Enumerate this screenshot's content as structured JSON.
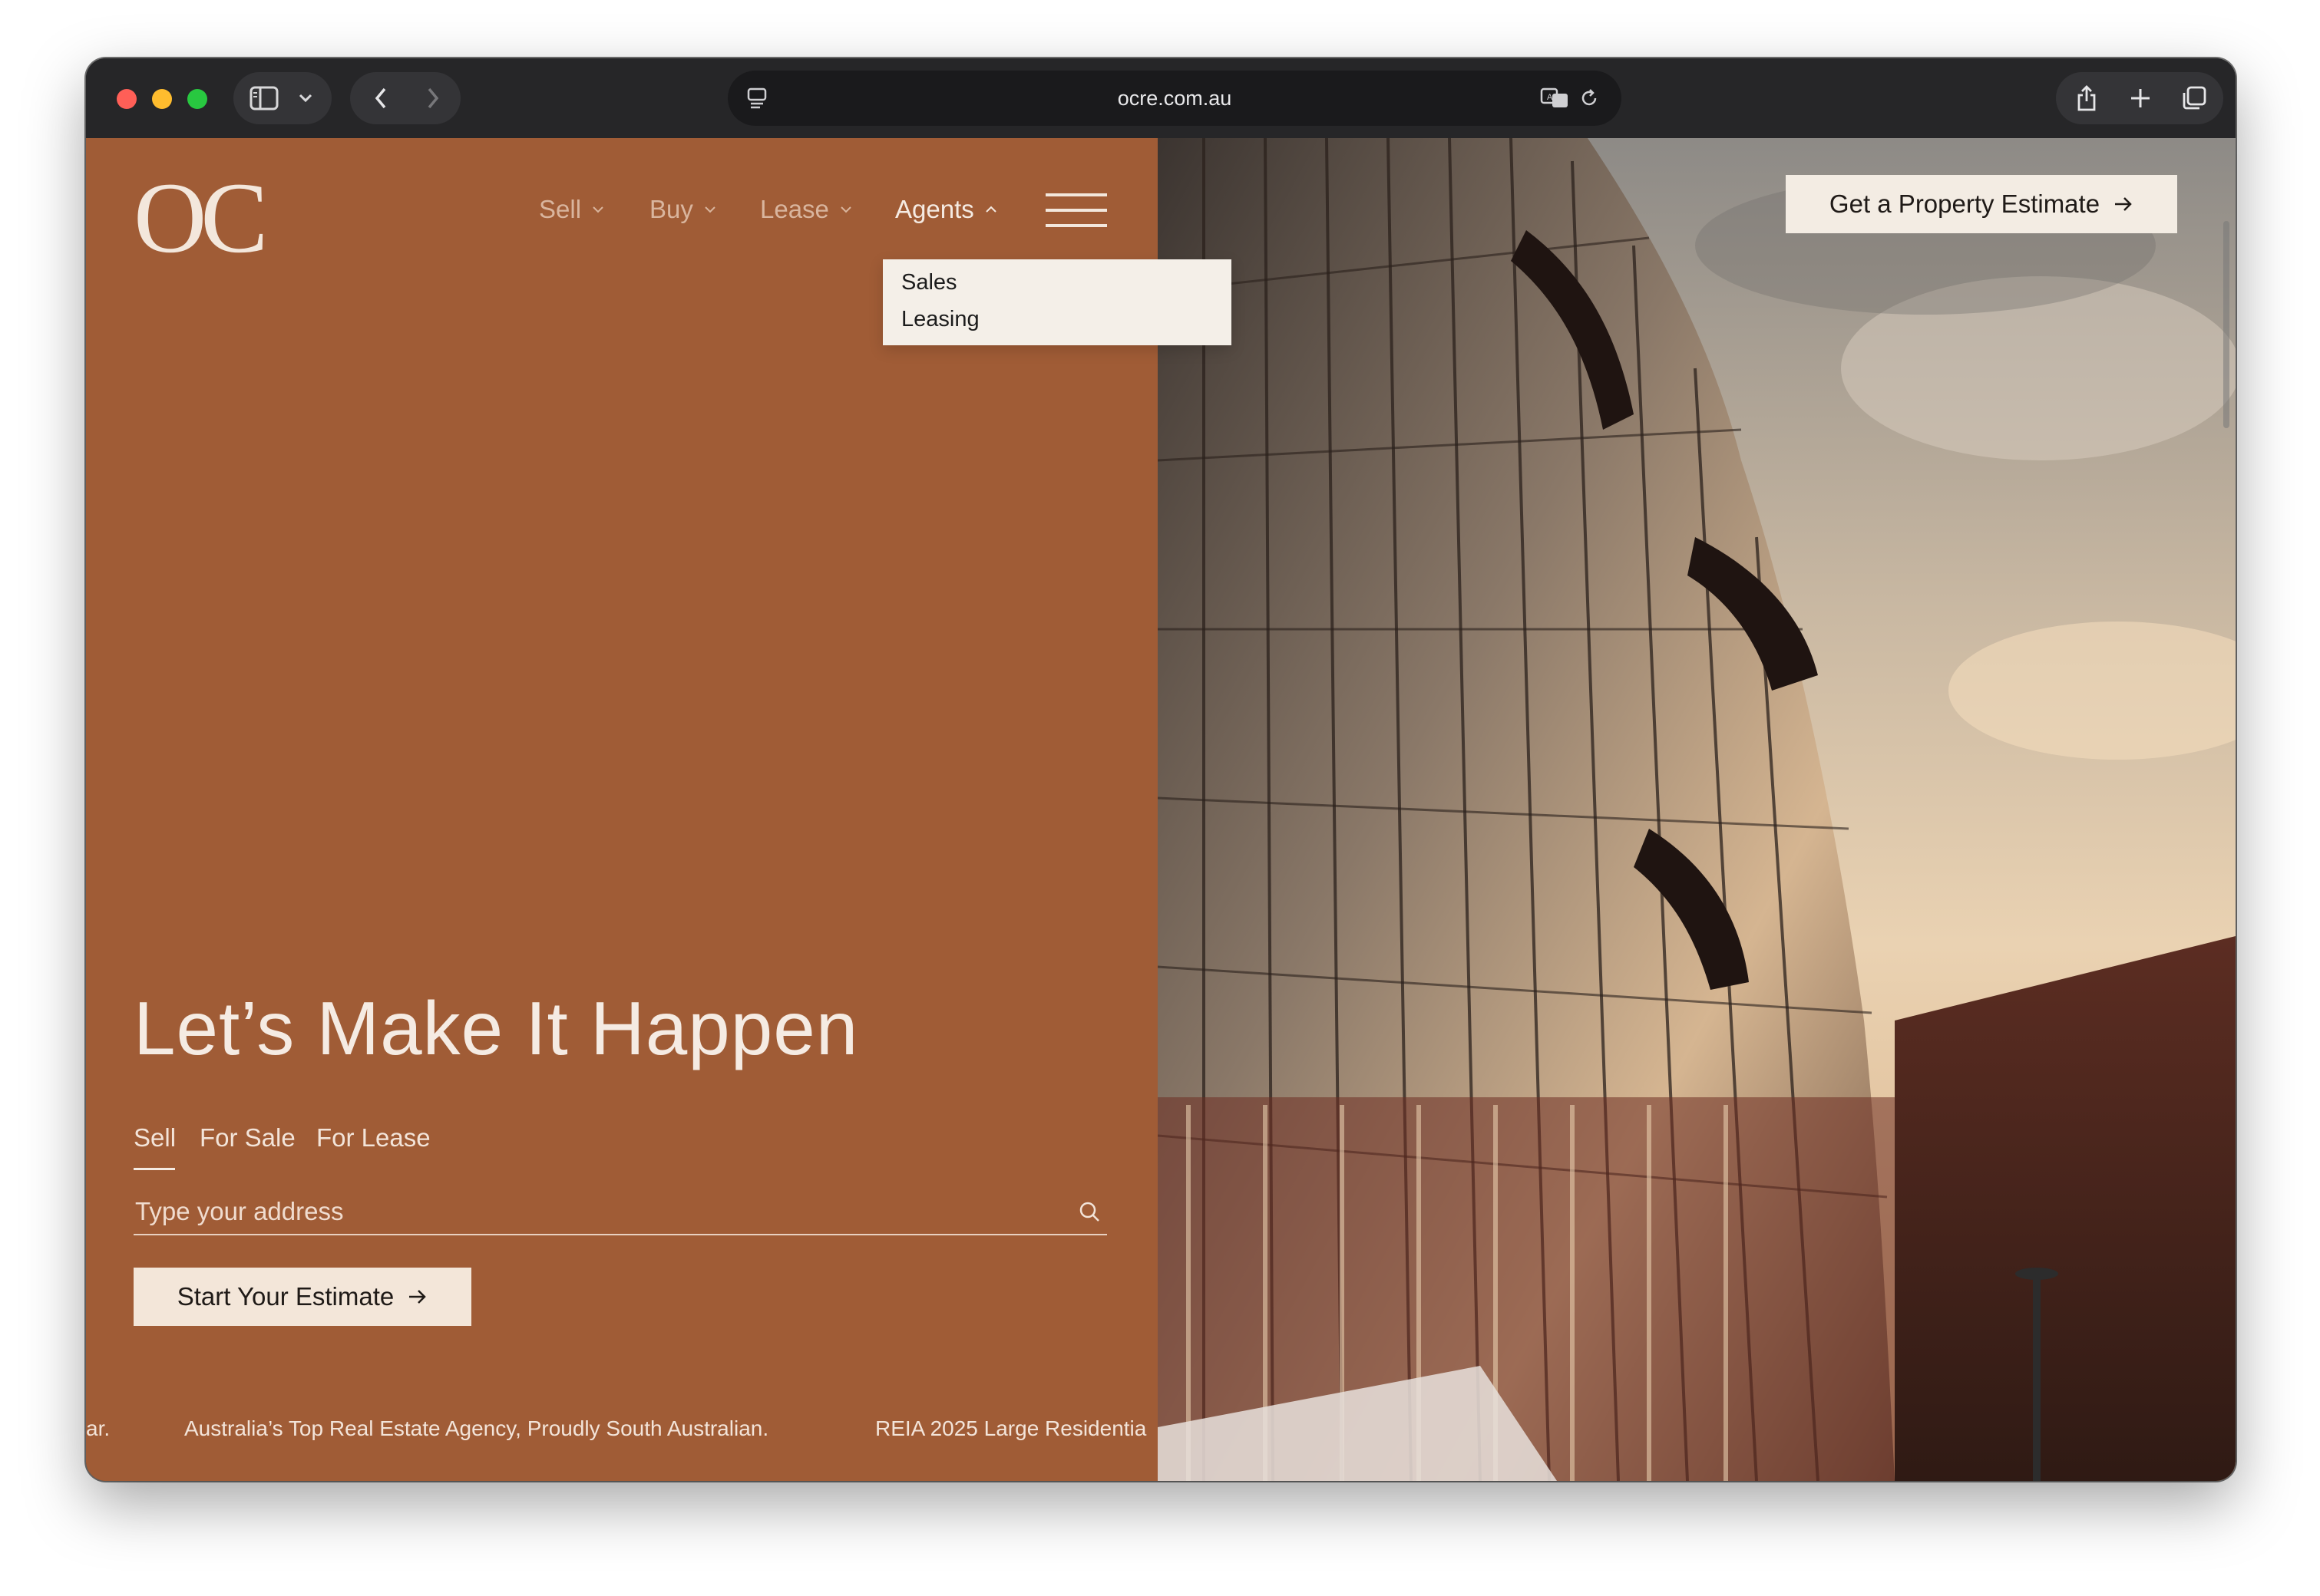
{
  "browser": {
    "url": "ocre.com.au"
  },
  "brand": {
    "logo": "OC",
    "colors": {
      "panel": "#a05c36",
      "cream": "#f3ece3"
    }
  },
  "nav": {
    "items": [
      {
        "label": "Sell"
      },
      {
        "label": "Buy"
      },
      {
        "label": "Lease"
      },
      {
        "label": "Agents"
      }
    ],
    "dropdown": [
      "Sales",
      "Leasing"
    ],
    "cta": "Get a Property Estimate"
  },
  "hero": {
    "headline": "Let’s Make It Happen",
    "tabs": [
      "Sell",
      "For Sale",
      "For Lease"
    ],
    "active_tab": "Sell",
    "search_placeholder": "Type your address",
    "button": "Start Your Estimate"
  },
  "ticker": {
    "items": [
      "ar.",
      "Australia’s Top Real Estate Agency, Proudly South Australian.",
      "REIA 2025 Large Residentia"
    ]
  }
}
